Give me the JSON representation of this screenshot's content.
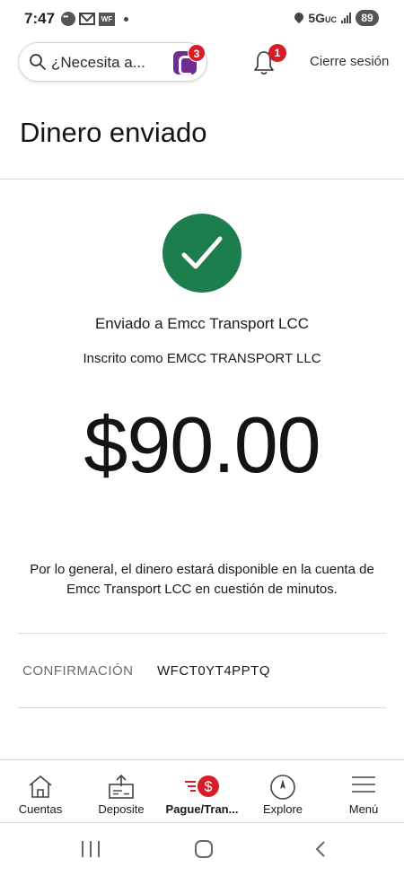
{
  "status_bar": {
    "time": "7:47",
    "wf_icon_text": "WF",
    "network": "5G",
    "network_suffix": "UC",
    "battery": "89"
  },
  "top_nav": {
    "search_placeholder": "¿Necesita a...",
    "fargo_badge": "3",
    "notifications_badge": "1",
    "logout_label": "Cierre sesión"
  },
  "page": {
    "title": "Dinero enviado",
    "sent_to": "Enviado a Emcc Transport LCC",
    "registered_as": "Inscrito como EMCC TRANSPORT LLC",
    "amount": "$90.00",
    "info_text": "Por lo general, el dinero estará disponible en la cuenta de Emcc Transport LCC en cuestión de minutos.",
    "confirmation_label": "CONFIRMACIÓN",
    "confirmation_value": "WFCT0YT4PPTQ"
  },
  "tabs": [
    {
      "label": "Cuentas",
      "icon": "home-icon",
      "active": false
    },
    {
      "label": "Deposite",
      "icon": "deposit-icon",
      "active": false
    },
    {
      "label": "Pague/Tran...",
      "icon": "pay-transfer-icon",
      "active": true
    },
    {
      "label": "Explore",
      "icon": "compass-icon",
      "active": false
    },
    {
      "label": "Menú",
      "icon": "menu-icon",
      "active": false
    }
  ],
  "colors": {
    "success_green": "#1b7e4c",
    "badge_red": "#d71e28",
    "fargo_purple": "#6e2c91"
  }
}
